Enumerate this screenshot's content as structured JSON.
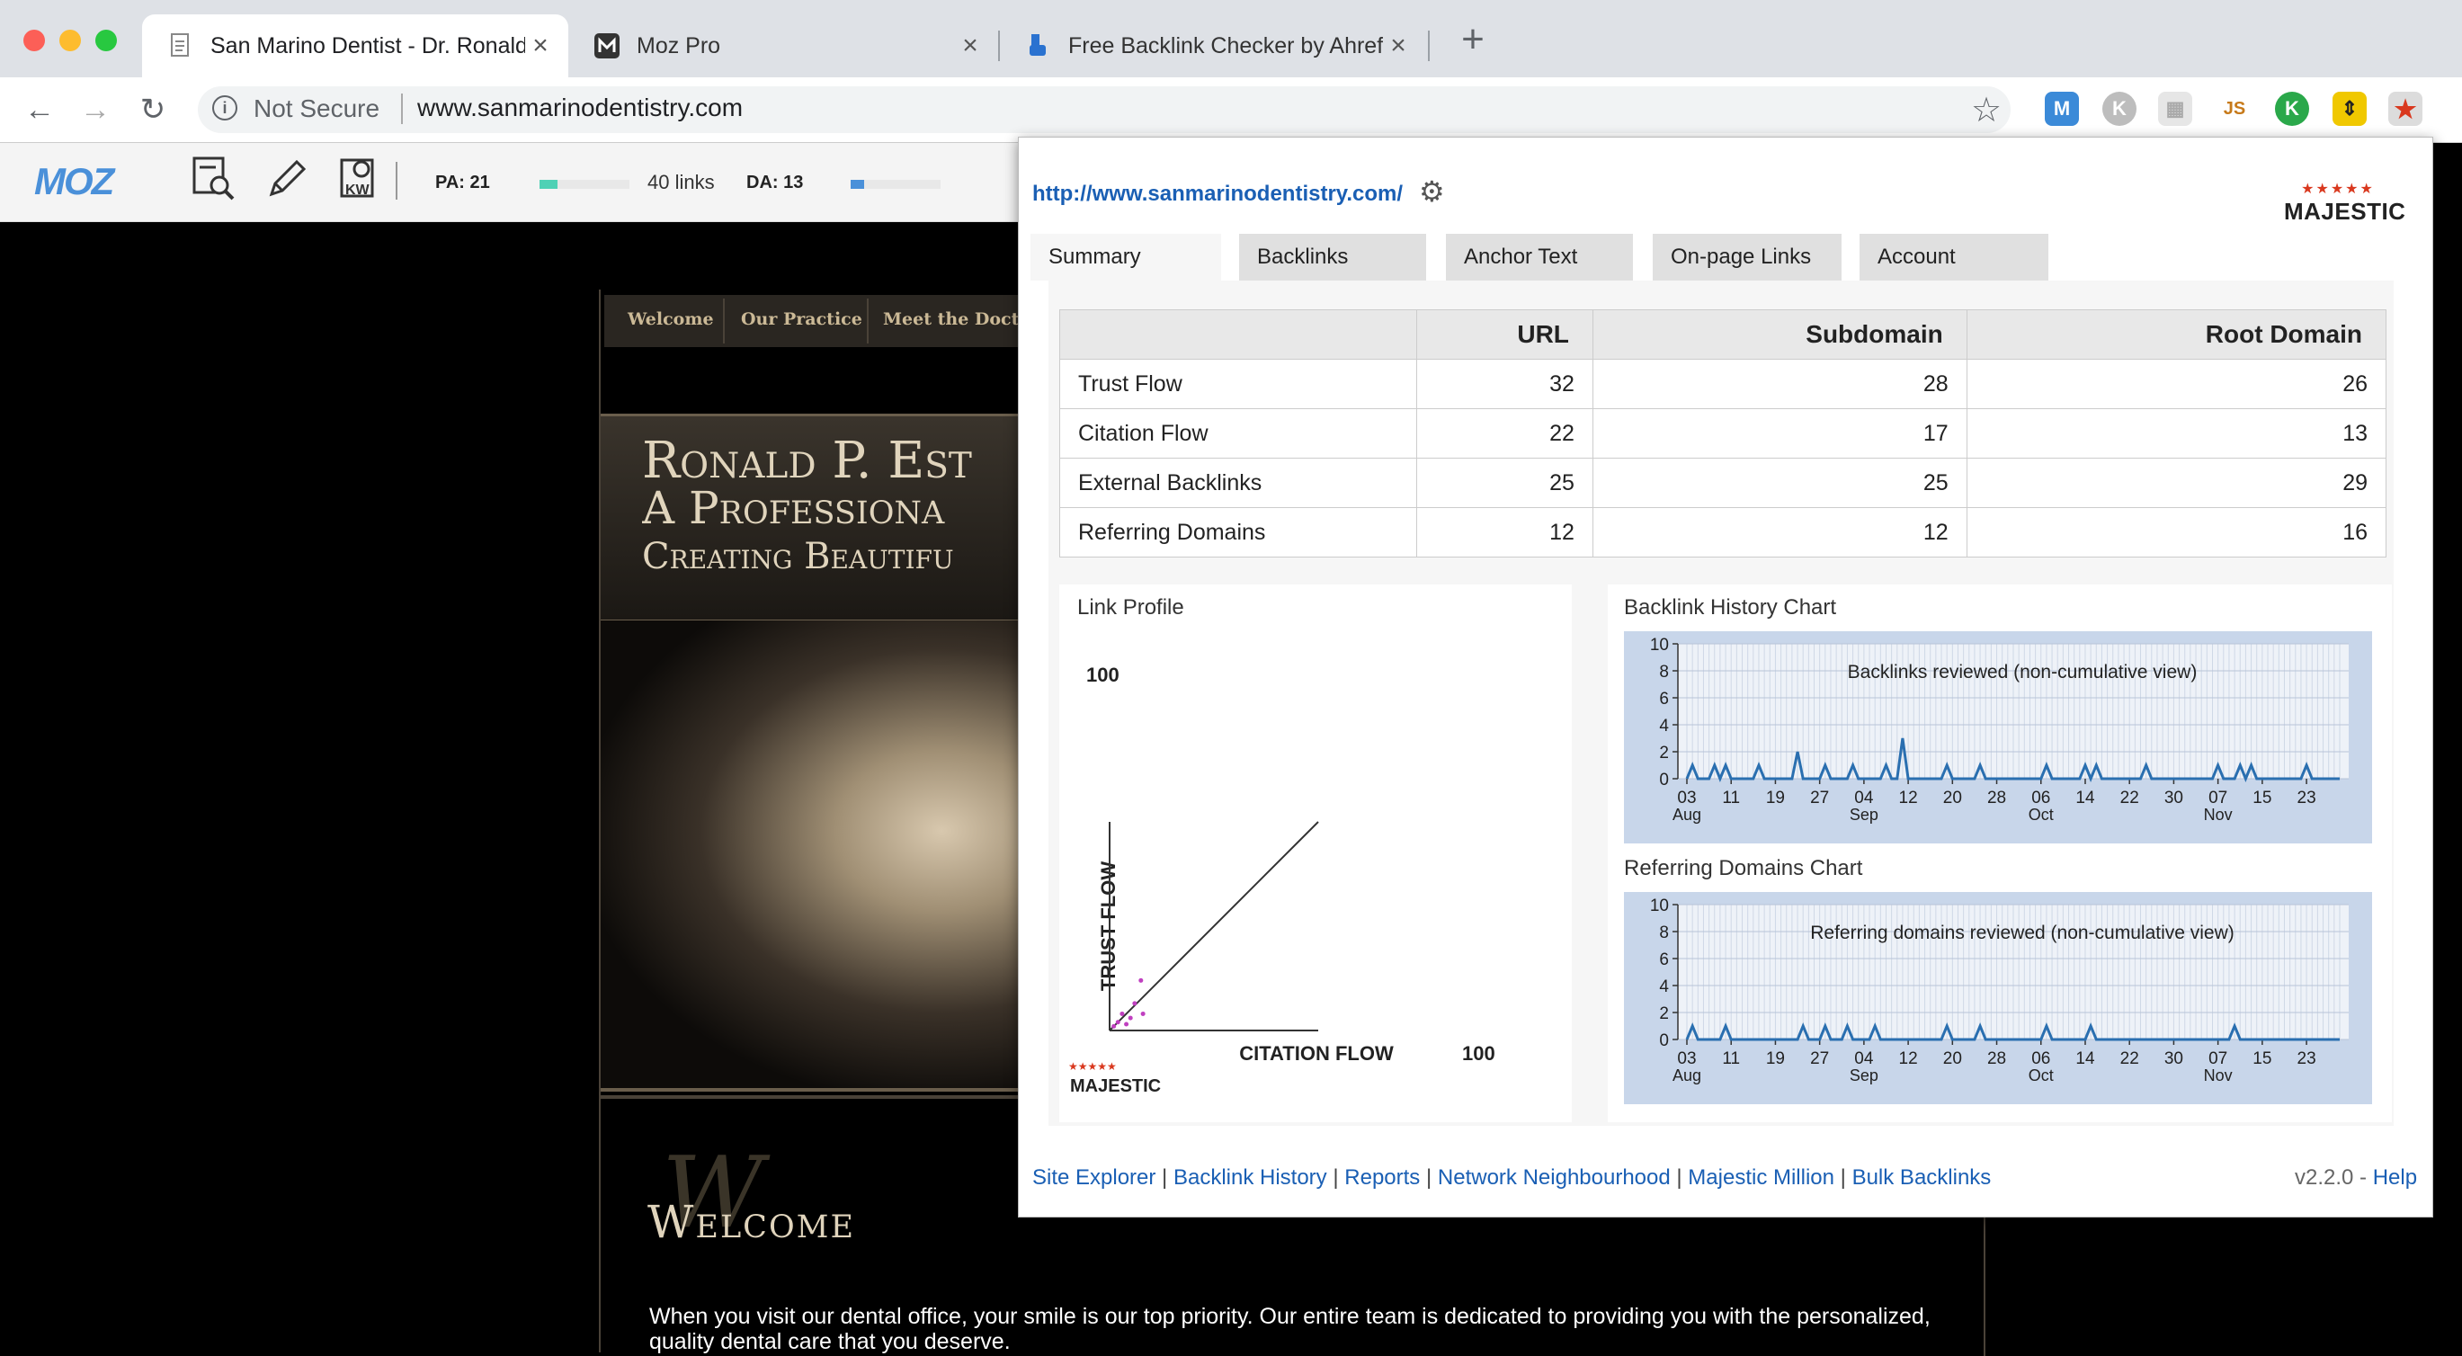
{
  "browser": {
    "tabs": [
      {
        "title": "San Marino Dentist - Dr. Ronald",
        "active": true,
        "favicon": "page-icon"
      },
      {
        "title": "Moz Pro",
        "active": false,
        "favicon": "moz-m-icon"
      },
      {
        "title": "Free Backlink Checker by Ahrefs",
        "active": false,
        "favicon": "ahrefs-icon"
      }
    ],
    "security_label": "Not Secure",
    "url": "www.sanmarinodentistry.com"
  },
  "mozbar": {
    "logo": "MOZ",
    "pa_label": "PA: 21",
    "pa_fill": 0.2,
    "links_label": "40 links",
    "da_label": "DA: 13",
    "da_fill": 0.15,
    "accent": "#4fd1b5",
    "da_accent": "#4a90d9"
  },
  "site": {
    "nav": [
      "Welcome",
      "Our Practice",
      "Meet the Doctor"
    ],
    "hero_lines": [
      "Ronald P. Est",
      "A Professiona",
      "Creating Beautifu"
    ],
    "welcome_initial": "W",
    "welcome_title": "Welcome",
    "body_text": "When you visit our dental office, your smile is our top priority.  Our entire team is dedicated to providing you with the personalized, quality dental care that you deserve."
  },
  "majestic": {
    "url": "http://www.sanmarinodentistry.com/",
    "logo_text": "MAJESTIC",
    "tabs": [
      "Summary",
      "Backlinks",
      "Anchor Text",
      "On-page Links",
      "Account"
    ],
    "active_tab": "Summary",
    "table": {
      "headers": [
        "",
        "URL",
        "Subdomain",
        "Root Domain"
      ],
      "rows": [
        {
          "label": "Trust Flow",
          "url": "32",
          "subdomain": "28",
          "root": "26"
        },
        {
          "label": "Citation Flow",
          "url": "22",
          "subdomain": "17",
          "root": "13"
        },
        {
          "label": "External Backlinks",
          "url": "25",
          "subdomain": "25",
          "root": "29"
        },
        {
          "label": "Referring Domains",
          "url": "12",
          "subdomain": "12",
          "root": "16"
        }
      ]
    },
    "link_profile": {
      "title": "Link Profile",
      "ylabel": "TRUST FLOW",
      "xlabel": "CITATION FLOW",
      "y_max_label": "100",
      "x_max_label": "100",
      "logo_text": "MAJESTIC"
    },
    "backlink_chart": {
      "title": "Backlink History Chart",
      "subtitle": "Backlinks reviewed (non-cumulative view)"
    },
    "referring_chart": {
      "title": "Referring Domains Chart",
      "subtitle": "Referring domains reviewed (non-cumulative view)"
    },
    "footer_links": [
      "Site Explorer",
      "Backlink History",
      "Reports",
      "Network Neighbourhood",
      "Majestic Million",
      "Bulk Backlinks"
    ],
    "version": "v2.2.0",
    "help": "Help"
  },
  "chart_data": [
    {
      "type": "scatter",
      "title": "Link Profile",
      "xlabel": "CITATION FLOW",
      "ylabel": "TRUST FLOW",
      "xlim": [
        0,
        100
      ],
      "ylim": [
        0,
        100
      ],
      "diagonal": true,
      "points": [
        [
          15,
          24
        ],
        [
          6,
          8
        ],
        [
          12,
          13
        ],
        [
          16,
          8
        ],
        [
          10,
          6
        ],
        [
          4,
          4
        ],
        [
          8,
          3
        ],
        [
          2,
          2
        ]
      ],
      "color": "#c040c0"
    },
    {
      "type": "line",
      "title": "Backlinks reviewed (non-cumulative view)",
      "ylim": [
        0,
        10
      ],
      "yticks": [
        0,
        2,
        4,
        6,
        8,
        10
      ],
      "xticks": [
        "03",
        "11",
        "19",
        "27",
        "04",
        "12",
        "20",
        "28",
        "06",
        "14",
        "22",
        "30",
        "07",
        "15",
        "23"
      ],
      "month_labels": [
        {
          "label": "Aug",
          "at": "03"
        },
        {
          "label": "Sep",
          "at": "04"
        },
        {
          "label": "Oct",
          "at": "06"
        },
        {
          "label": "Nov",
          "at": "07"
        }
      ],
      "x_days": 118,
      "spikes": [
        [
          1,
          1
        ],
        [
          5,
          1
        ],
        [
          7,
          1
        ],
        [
          13,
          1
        ],
        [
          20,
          2
        ],
        [
          25,
          1
        ],
        [
          30,
          1
        ],
        [
          36,
          1
        ],
        [
          39,
          3
        ],
        [
          47,
          1
        ],
        [
          53,
          1
        ],
        [
          65,
          1
        ],
        [
          72,
          1
        ],
        [
          74,
          1
        ],
        [
          83,
          1
        ],
        [
          96,
          1
        ],
        [
          100,
          1
        ],
        [
          102,
          1
        ],
        [
          112,
          1
        ]
      ],
      "color": "#2a6fb0",
      "grid": true
    },
    {
      "type": "line",
      "title": "Referring domains reviewed (non-cumulative view)",
      "ylim": [
        0,
        10
      ],
      "yticks": [
        0,
        2,
        4,
        6,
        8,
        10
      ],
      "xticks": [
        "03",
        "11",
        "19",
        "27",
        "04",
        "12",
        "20",
        "28",
        "06",
        "14",
        "22",
        "30",
        "07",
        "15",
        "23"
      ],
      "month_labels": [
        {
          "label": "Aug",
          "at": "03"
        },
        {
          "label": "Sep",
          "at": "04"
        },
        {
          "label": "Oct",
          "at": "06"
        },
        {
          "label": "Nov",
          "at": "07"
        }
      ],
      "x_days": 118,
      "spikes": [
        [
          1,
          1
        ],
        [
          7,
          1
        ],
        [
          21,
          1
        ],
        [
          25,
          1
        ],
        [
          29,
          1
        ],
        [
          34,
          1
        ],
        [
          47,
          1
        ],
        [
          53,
          1
        ],
        [
          65,
          1
        ],
        [
          73,
          1
        ],
        [
          99,
          1
        ]
      ],
      "color": "#2a6fb0",
      "grid": true
    }
  ]
}
